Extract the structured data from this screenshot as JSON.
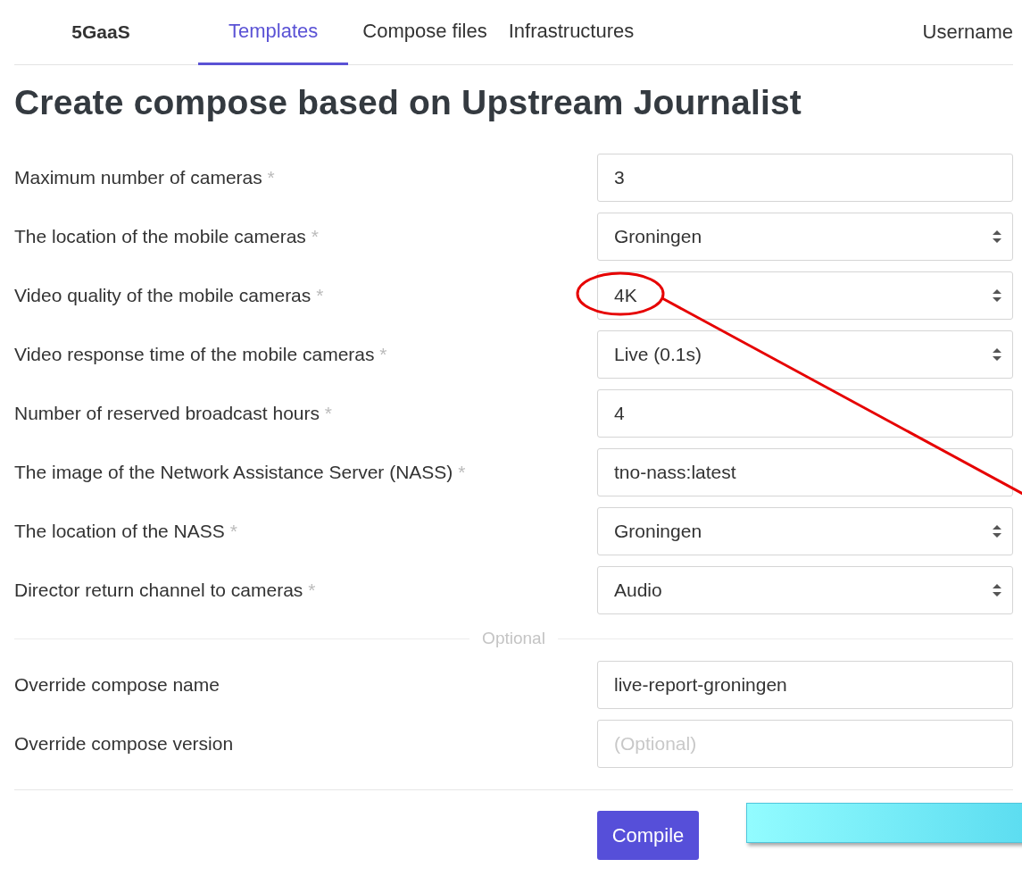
{
  "nav": {
    "brand": "5GaaS",
    "tabs": [
      {
        "label": "Templates",
        "selected": true
      },
      {
        "label": "Compose files",
        "selected": false
      },
      {
        "label": "Infrastructures",
        "selected": false
      }
    ],
    "user": "Username"
  },
  "title": "Create compose based on Upstream Journalist",
  "fields": [
    {
      "label": "Maximum number of cameras",
      "required_mark": "*",
      "kind": "text",
      "value": "3"
    },
    {
      "label": "The location of the mobile cameras",
      "required_mark": "*",
      "kind": "select",
      "value": "Groningen"
    },
    {
      "label": "Video quality of the mobile cameras",
      "required_mark": "*",
      "kind": "select",
      "value": "4K"
    },
    {
      "label": "Video response time of the mobile cameras",
      "required_mark": "*",
      "kind": "select",
      "value": "Live (0.1s)"
    },
    {
      "label": "Number of reserved broadcast hours",
      "required_mark": "*",
      "kind": "text",
      "value": "4"
    },
    {
      "label": "The image of the Network Assistance Server (NASS)",
      "required_mark": "*",
      "kind": "text",
      "value": "tno-nass:latest"
    },
    {
      "label": "The location of the NASS",
      "required_mark": "*",
      "kind": "select",
      "value": "Groningen"
    },
    {
      "label": "Director return channel to cameras",
      "required_mark": "*",
      "kind": "select",
      "value": "Audio"
    }
  ],
  "optional_divider": "Optional",
  "optional_fields": [
    {
      "label": "Override compose name",
      "kind": "text",
      "value": "live-report-groningen"
    },
    {
      "label": "Override compose version",
      "kind": "text",
      "placeholder": "(Optional)"
    }
  ],
  "compile_button": "Compile"
}
